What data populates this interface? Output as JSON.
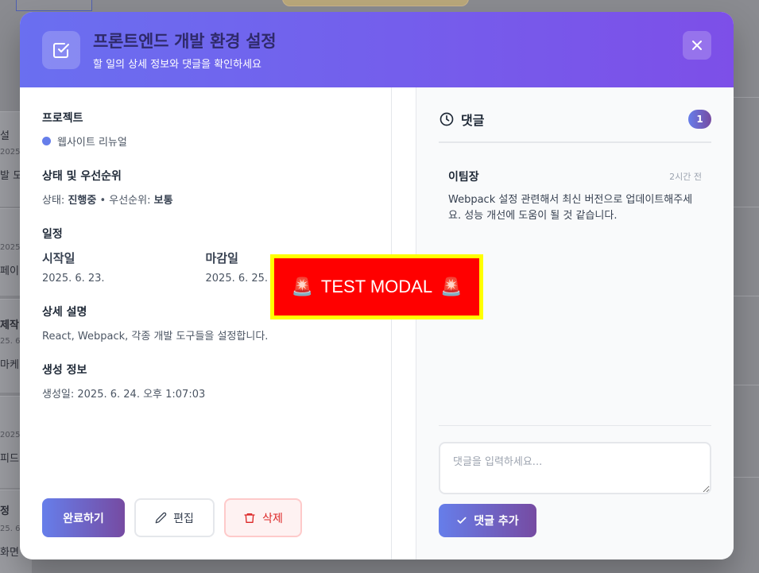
{
  "background": {
    "items": [
      {
        "title": "설",
        "date": "2025.",
        "desc": "발 도"
      },
      {
        "title": "",
        "date": "2025.",
        "desc": "페이"
      },
      {
        "title": "제작",
        "date": "25. 6",
        "desc": "마케"
      },
      {
        "title": "",
        "date": "2025.",
        "desc": " 피드"
      },
      {
        "title": "정",
        "date": "25. 6",
        "desc": " 화면"
      }
    ]
  },
  "modal": {
    "title": "프론트엔드 개발 환경 설정",
    "subtitle": "할 일의 상세 정보와 댓글을 확인하세요",
    "close_label": "×",
    "project": {
      "label": "프로젝트",
      "name": "웹사이트 리뉴얼",
      "color": "#667eea"
    },
    "status": {
      "label": "상태 및 우선순위",
      "status_prefix": "상태: ",
      "status_value": "진행중",
      "separator": " • ",
      "priority_prefix": "우선순위: ",
      "priority_value": "보통"
    },
    "schedule": {
      "label": "일정",
      "start_label": "시작일",
      "start_value": "2025. 6. 23.",
      "due_label": "마감일",
      "due_value": "2025. 6. 25."
    },
    "description": {
      "label": "상세 설명",
      "text": "React, Webpack, 각종 개발 도구들을 설정합니다."
    },
    "created": {
      "label": "생성 정보",
      "text": "생성일: 2025. 6. 24. 오후 1:07:03"
    },
    "actions": {
      "complete": "완료하기",
      "edit": "편집",
      "delete": "삭제"
    },
    "comments": {
      "title": "댓글",
      "count": "1",
      "items": [
        {
          "author": "이팀장",
          "time": "2시간 전",
          "text": "Webpack 설정 관련해서 최신 버전으로 업데이트해주세요. 성능 개선에 도움이 될 것 같습니다."
        }
      ],
      "input_placeholder": "댓글을 입력하세요...",
      "add_button": "댓글 추가"
    }
  },
  "test_modal": {
    "text": "TEST MODAL",
    "icon": "siren-icon"
  },
  "colors": {
    "header_start": "#6a6ff0",
    "header_end": "#7d4fe8",
    "accent": "#667eea",
    "delete": "#dc2626",
    "test_modal_bg": "#ff0000",
    "test_modal_border": "#ffff00"
  }
}
